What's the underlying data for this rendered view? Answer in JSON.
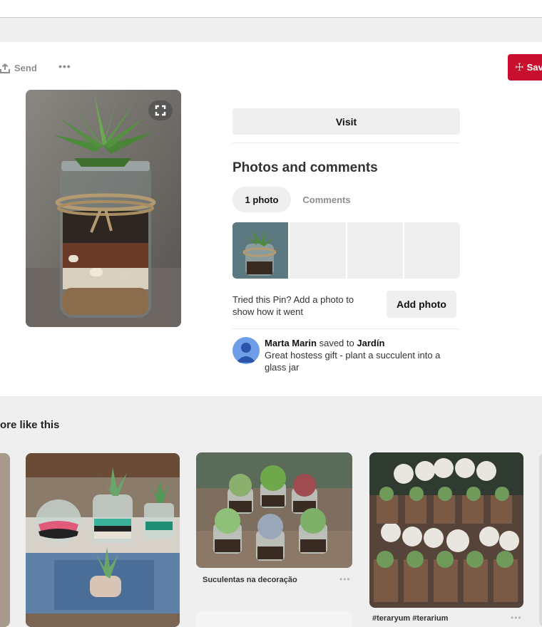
{
  "toolbar": {
    "send_label": "Send",
    "more_label": "•••",
    "save_label": "Sav"
  },
  "pin": {
    "visit_label": "Visit"
  },
  "photos_section": {
    "title": "Photos and comments",
    "tabs": [
      {
        "label": "1 photo",
        "active": true
      },
      {
        "label": "Comments",
        "active": false
      }
    ],
    "tried_text": "Tried this Pin? Add a photo to show how it went",
    "add_photo_label": "Add photo"
  },
  "saved_by": {
    "user": "Marta Marin",
    "verb": "saved to",
    "board": "Jardín",
    "description": "Great hostess gift - plant a succulent into a glass jar"
  },
  "more_like_this": {
    "title": "ore like this",
    "pins": [
      {
        "caption": ""
      },
      {
        "caption": "Suculentas na decoração",
        "more": "•••"
      },
      {
        "caption": "#teraryum #terarium",
        "more": "•••"
      }
    ]
  },
  "colors": {
    "save_red": "#c8102e",
    "background": "#efefef",
    "avatar_blue": "#6f9ee8"
  }
}
